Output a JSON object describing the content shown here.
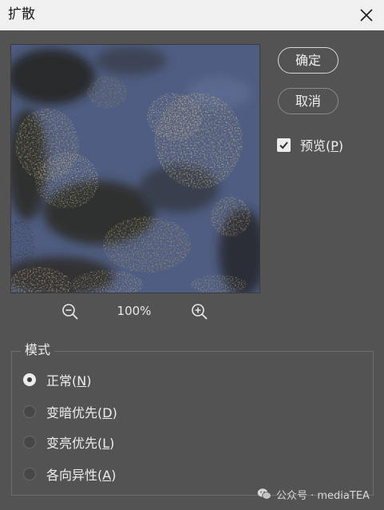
{
  "window": {
    "title": "扩散",
    "close_icon": "close-icon"
  },
  "preview": {
    "zoom_level": "100%",
    "zoom_out_icon": "zoom-out-icon",
    "zoom_in_icon": "zoom-in-icon"
  },
  "buttons": {
    "ok_label": "确定",
    "cancel_label": "取消"
  },
  "preview_toggle": {
    "label": "预览(",
    "mnemonic": "P",
    "label_end": ")",
    "checked": true
  },
  "mode": {
    "legend": "模式",
    "options": [
      {
        "label": "正常(",
        "mnemonic": "N",
        "label_end": ")",
        "selected": true
      },
      {
        "label": "变暗优先(",
        "mnemonic": "D",
        "label_end": ")",
        "selected": false
      },
      {
        "label": "变亮优先(",
        "mnemonic": "L",
        "label_end": ")",
        "selected": false
      },
      {
        "label": "各向异性(",
        "mnemonic": "A",
        "label_end": ")",
        "selected": false
      }
    ]
  },
  "watermark": {
    "text": "公众号 · mediaTEA",
    "icon": "wechat-icon"
  },
  "colors": {
    "dialog_bg": "#535353",
    "titlebar_bg": "#f0f0f0",
    "text": "#eeeeee"
  }
}
